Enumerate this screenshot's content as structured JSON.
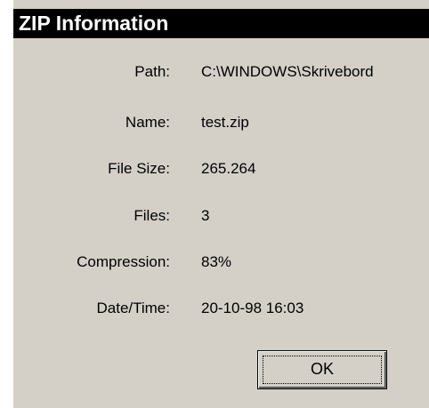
{
  "dialog": {
    "title": "ZIP Information"
  },
  "fields": [
    {
      "label": "Path:",
      "value": "C:\\WINDOWS\\Skrivebord"
    },
    {
      "label": "Name:",
      "value": "test.zip"
    },
    {
      "label": "File Size:",
      "value": "265.264"
    },
    {
      "label": "Files:",
      "value": "3"
    },
    {
      "label": "Compression:",
      "value": "83%"
    },
    {
      "label": "Date/Time:",
      "value": "20-10-98  16:03"
    }
  ],
  "buttons": {
    "ok_label": "OK"
  },
  "colors": {
    "title_background": "#000000",
    "title_text": "#ffffff",
    "dialog_background": "#d4d0c8"
  }
}
